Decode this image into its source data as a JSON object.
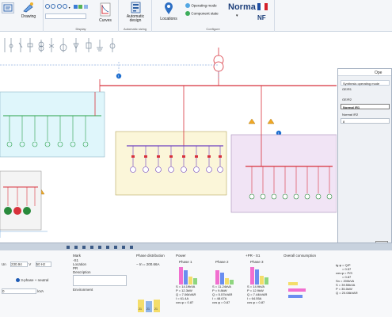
{
  "ribbon": {
    "drawing_label": "Drawing",
    "curves_label": "Curves",
    "automatic_design_label": "Automatic design",
    "locations_label": "Locations",
    "operating_mode_label": "Operating mode",
    "component_state_label": "Component state",
    "norma_label": "Norma",
    "nf_label": "NF",
    "group_display": "Display",
    "group_automatic_sizing": "Automatic sizing",
    "group_configure": "Configure",
    "flag_colors": [
      "#1f4fa3",
      "#ffffff",
      "#d4202a"
    ]
  },
  "dialog": {
    "title": "Ope",
    "rows": [
      "Synthesis operating mode",
      "GE/R1",
      "GE/R2",
      "Normal /R1",
      "Normal /R2",
      "8"
    ],
    "ok_label": "OK"
  },
  "bottom": {
    "voltage_label": "Un",
    "voltage_value": "230.94",
    "voltage_unit": "V",
    "freq_value": "50 Hz",
    "phase_option": "3-phase + neutral",
    "power_value": "0",
    "power_unit": "kVA",
    "mark_label": "Mark",
    "mark_value": "-S1",
    "location_label": "Location",
    "location_value": "PR",
    "description_label": "Description",
    "environment_label": "Environment",
    "phase_distribution_label": "Phase distribution",
    "phase_distribution_value": "− In = 200.66A",
    "phase_dist_bar_labels": [
      "21",
      "21",
      "21"
    ],
    "power_title": "Power",
    "phase1_label": "Phase 1",
    "phase2_label": "Phase 2",
    "phase3_label": "Phase 3",
    "pr_title": "+PR - S1",
    "overall_label": "Overall consumption",
    "phase1_lines": [
      "S = 14.19kVA",
      "P = 12.3kW",
      "Q = 7.06kVAR",
      "I = 61.4A",
      "cos φ = 0.87"
    ],
    "phase2_lines": [
      "S = 11.24kVA",
      "P = 9.8kW",
      "Q = 5.57kVAR",
      "I = 48.67A",
      "cos φ = 0.87"
    ],
    "phase3_lines": [
      "S = 14.9kVA",
      "P = 12.9kW",
      "Q = 7.44kVAR",
      "I = 64.55A",
      "cos φ = 0.87"
    ],
    "overall_lines": [
      "tg φ = Q/P",
      "= 0.57",
      "cos φ = P/S",
      "= 0.87",
      "Sn = 200kVA",
      "S = 39.55kVA",
      "P = 35.0kW",
      "Q = 20.08kVAR"
    ],
    "bar_colors": [
      "#f16fcf",
      "#6a8df0",
      "#f4dd6a",
      "#8fd67f"
    ]
  }
}
